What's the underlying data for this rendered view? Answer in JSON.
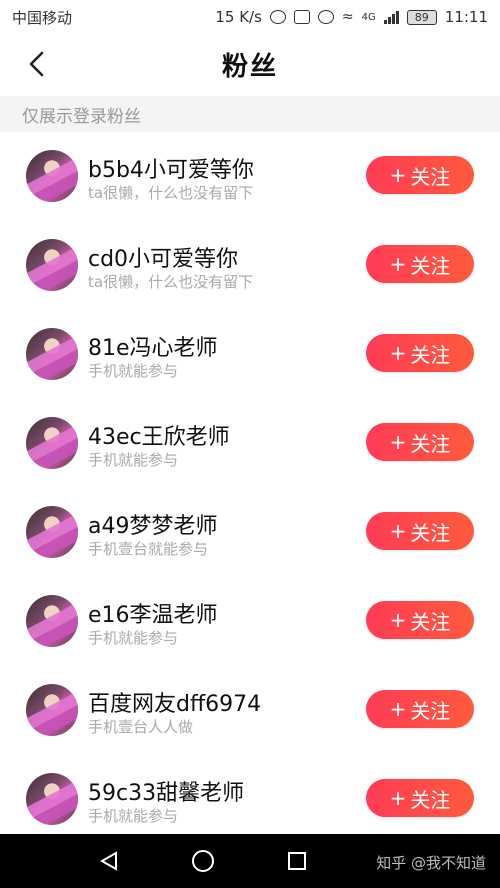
{
  "status_bar": {
    "carrier": "中国移动",
    "speed": "15 K/s",
    "network": "4G",
    "battery": "89",
    "time": "11:11"
  },
  "header": {
    "title": "粉丝",
    "back_icon": "chevron-left-icon"
  },
  "section_note": "仅展示登录粉丝",
  "fans": [
    {
      "name": "b5b4小可爱等你",
      "desc": "ta很懒，什么也没有留下",
      "follow_label": "关注"
    },
    {
      "name": "cd0小可爱等你",
      "desc": "ta很懒，什么也没有留下",
      "follow_label": "关注"
    },
    {
      "name": "81e冯心老师",
      "desc": "手机就能参与",
      "follow_label": "关注"
    },
    {
      "name": "43ec王欣老师",
      "desc": "手机就能参与",
      "follow_label": "关注"
    },
    {
      "name": "a49梦梦老师",
      "desc": "手机壹台就能参与",
      "follow_label": "关注"
    },
    {
      "name": "e16李温老师",
      "desc": "手机就能参与",
      "follow_label": "关注"
    },
    {
      "name": "百度网友dff6974",
      "desc": "手机壹台人人做",
      "follow_label": "关注"
    },
    {
      "name": "59c33甜馨老师",
      "desc": "手机就能参与",
      "follow_label": "关注"
    }
  ],
  "nav": {
    "back_icon": "triangle-back-icon",
    "home_icon": "circle-home-icon",
    "recent_icon": "square-recent-icon"
  },
  "watermark": "知乎 @我不知道",
  "colors": {
    "follow_button": "#ff3b56",
    "follow_button_end": "#ff5a3d",
    "section_bg": "#f4f4f4"
  }
}
